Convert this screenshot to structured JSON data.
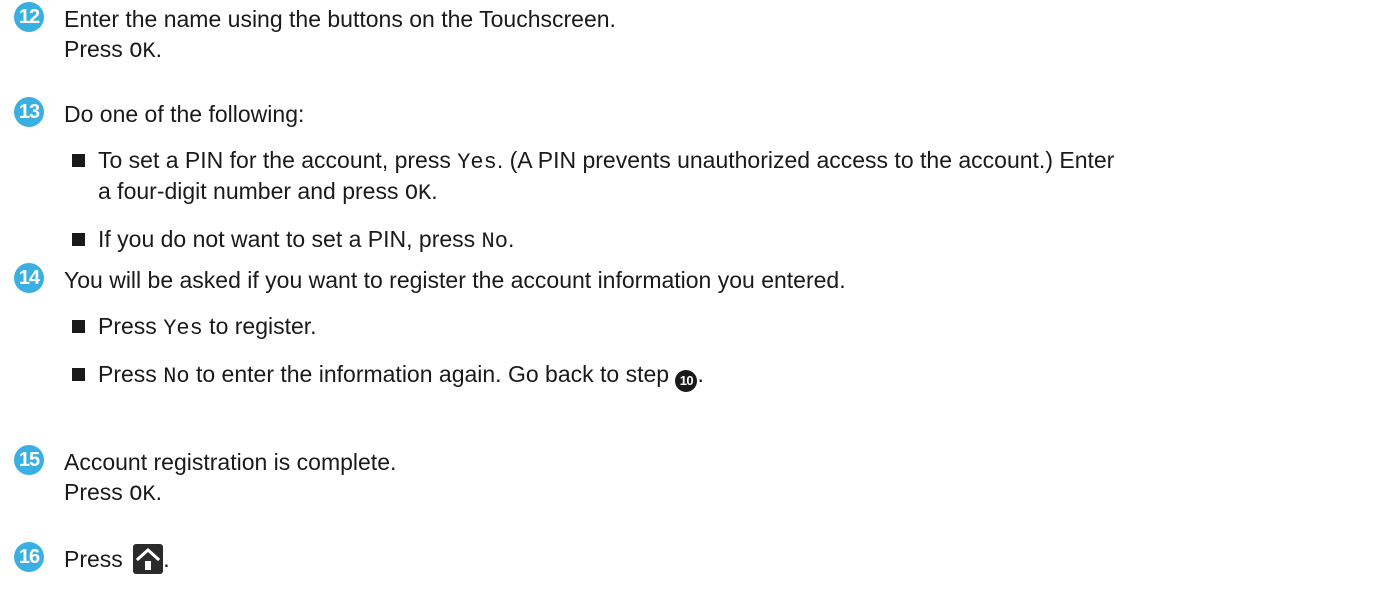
{
  "steps": [
    {
      "number": "12",
      "lines": [
        {
          "text": "Enter the name using the buttons on the Touchscreen."
        },
        {
          "pre": "Press ",
          "code": "OK",
          "post": "."
        }
      ]
    },
    {
      "number": "13",
      "intro": "Do one of the following:",
      "bullets": [
        {
          "pre": "To set a PIN for the account, press ",
          "code": "Yes",
          "mid": ". (A PIN prevents unauthorized access to the account.) Enter",
          "line2_pre": "a four-digit number and press ",
          "code2": "OK",
          "post": "."
        },
        {
          "pre": "If you do not want to set a PIN, press ",
          "code": "No",
          "post": "."
        }
      ]
    },
    {
      "number": "14",
      "intro": "You will be asked if you want to register the account information you entered.",
      "bullets": [
        {
          "pre": "Press ",
          "code": "Yes",
          "post": " to register."
        },
        {
          "pre": "Press ",
          "code": "No",
          "post": " to enter the information again. Go back to step ",
          "ref": "10",
          "post2": "."
        }
      ]
    },
    {
      "number": "15",
      "lines": [
        {
          "text": "Account registration is complete."
        },
        {
          "pre": "Press ",
          "code": "OK",
          "post": "."
        }
      ]
    },
    {
      "number": "16",
      "pre": "Press ",
      "icon": "home-icon",
      "post": "."
    }
  ],
  "colors": {
    "badge": "#3ab0e2",
    "text": "#1a1a1a"
  }
}
